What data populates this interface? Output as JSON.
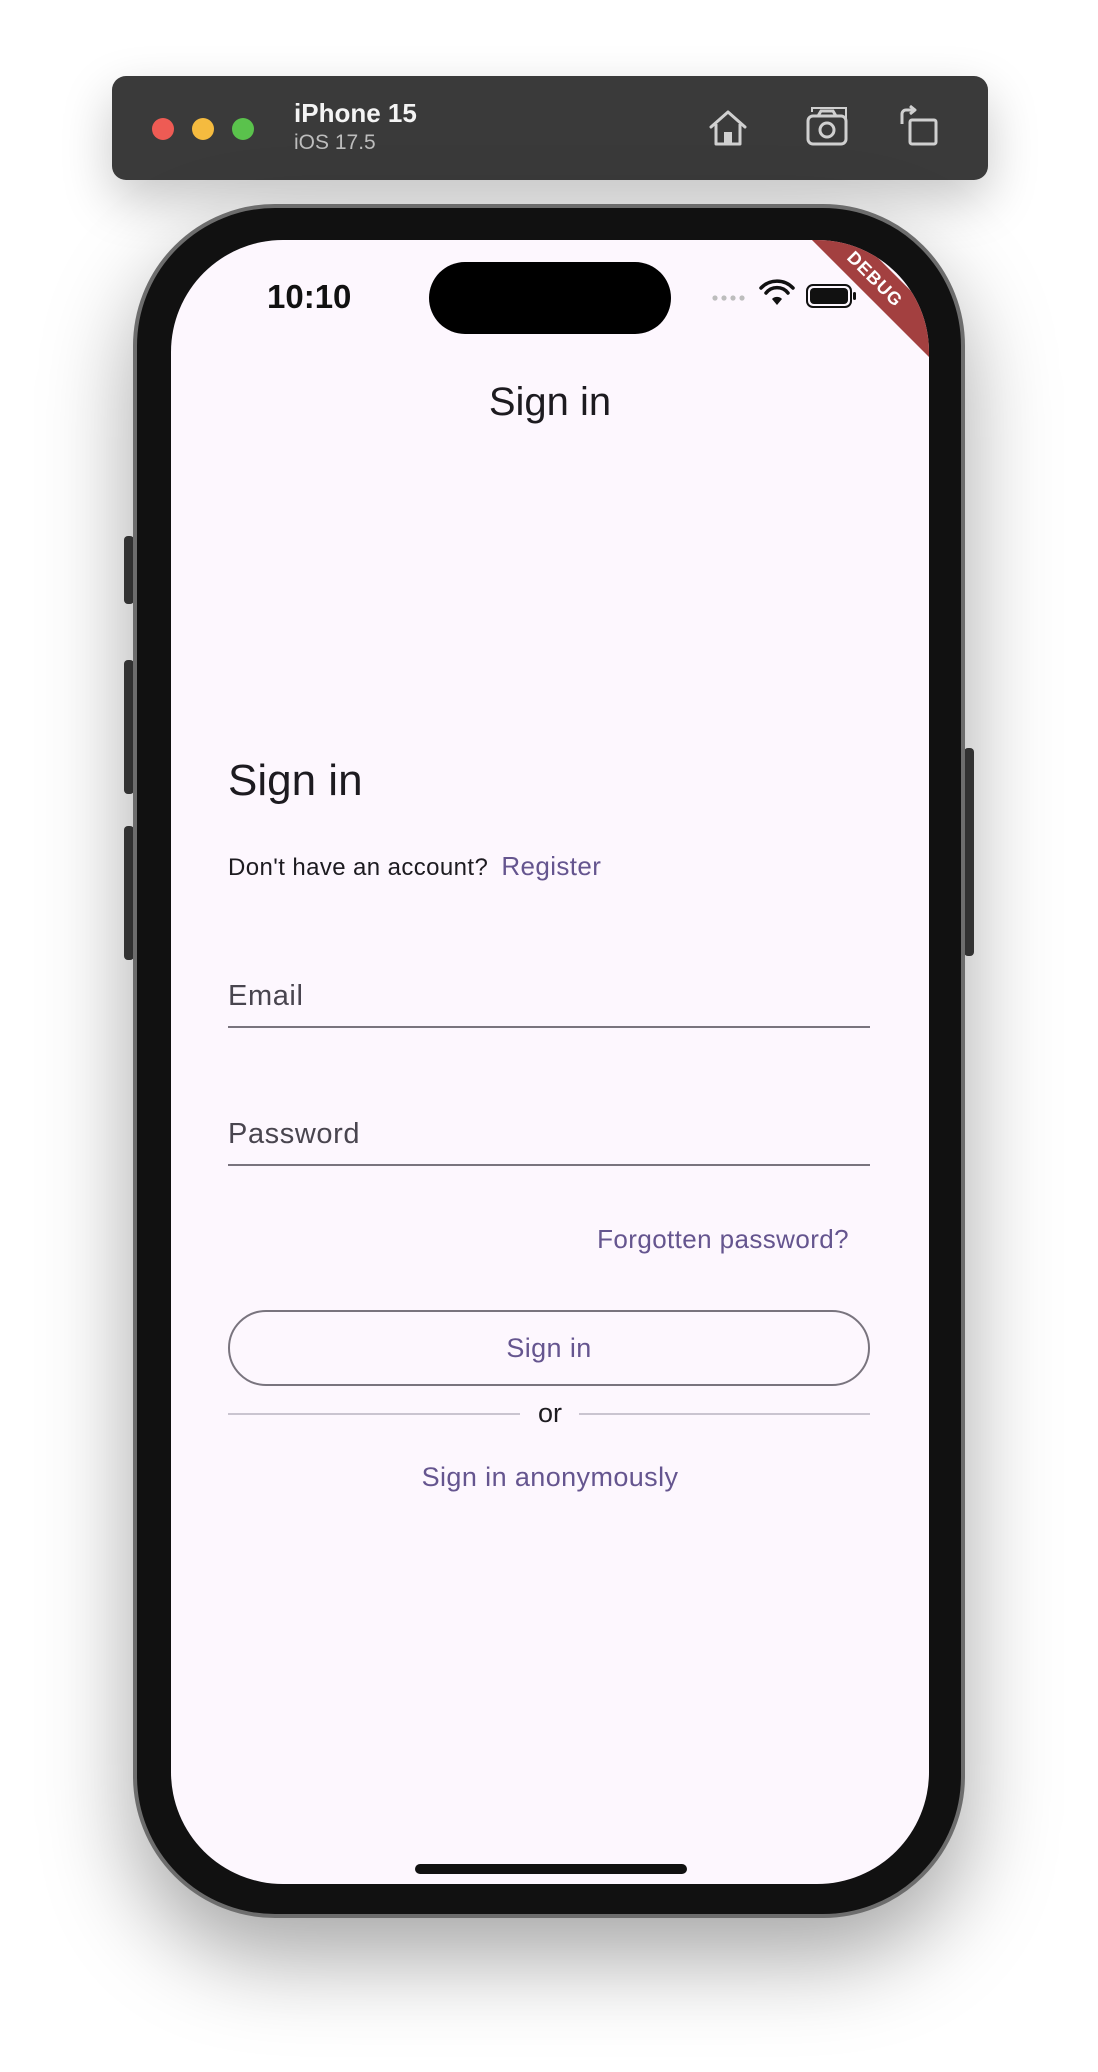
{
  "simulator": {
    "device_name": "iPhone 15",
    "os_version": "iOS 17.5",
    "home_icon": "home-icon",
    "screenshot_icon": "camera-icon",
    "rotate_icon": "rotate-icon"
  },
  "status_bar": {
    "time": "10:10",
    "debug_banner": "DEBUG"
  },
  "app_bar": {
    "title": "Sign in"
  },
  "form": {
    "heading": "Sign in",
    "no_account_text": "Don't have an account?",
    "register_link": "Register",
    "email_placeholder": "Email",
    "email_value": "",
    "password_placeholder": "Password",
    "password_value": "",
    "forgot_password_link": "Forgotten password?",
    "sign_in_button": "Sign in",
    "divider_text": "or",
    "anonymous_link": "Sign in anonymously"
  },
  "colors": {
    "background": "#fdf7fe",
    "accent": "#65558f",
    "text": "#1d1b20",
    "outline": "#79747e",
    "debug_banner": "#a34040"
  }
}
